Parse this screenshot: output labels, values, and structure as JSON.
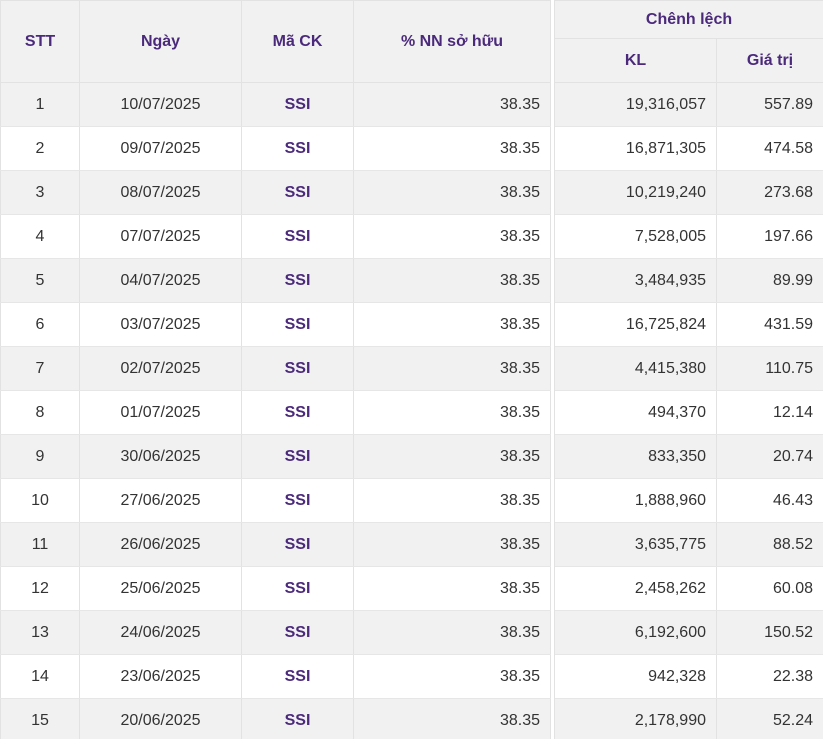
{
  "table": {
    "headers": {
      "stt": "STT",
      "date": "Ngày",
      "code": "Mã CK",
      "pct": "% NN sở hữu",
      "diff_group": "Chênh lệch",
      "kl": "KL",
      "value": "Giá trị"
    },
    "rows": [
      {
        "stt": "1",
        "date": "10/07/2025",
        "code": "SSI",
        "pct": "38.35",
        "kl": "19,316,057",
        "value": "557.89"
      },
      {
        "stt": "2",
        "date": "09/07/2025",
        "code": "SSI",
        "pct": "38.35",
        "kl": "16,871,305",
        "value": "474.58"
      },
      {
        "stt": "3",
        "date": "08/07/2025",
        "code": "SSI",
        "pct": "38.35",
        "kl": "10,219,240",
        "value": "273.68"
      },
      {
        "stt": "4",
        "date": "07/07/2025",
        "code": "SSI",
        "pct": "38.35",
        "kl": "7,528,005",
        "value": "197.66"
      },
      {
        "stt": "5",
        "date": "04/07/2025",
        "code": "SSI",
        "pct": "38.35",
        "kl": "3,484,935",
        "value": "89.99"
      },
      {
        "stt": "6",
        "date": "03/07/2025",
        "code": "SSI",
        "pct": "38.35",
        "kl": "16,725,824",
        "value": "431.59"
      },
      {
        "stt": "7",
        "date": "02/07/2025",
        "code": "SSI",
        "pct": "38.35",
        "kl": "4,415,380",
        "value": "110.75"
      },
      {
        "stt": "8",
        "date": "01/07/2025",
        "code": "SSI",
        "pct": "38.35",
        "kl": "494,370",
        "value": "12.14"
      },
      {
        "stt": "9",
        "date": "30/06/2025",
        "code": "SSI",
        "pct": "38.35",
        "kl": "833,350",
        "value": "20.74"
      },
      {
        "stt": "10",
        "date": "27/06/2025",
        "code": "SSI",
        "pct": "38.35",
        "kl": "1,888,960",
        "value": "46.43"
      },
      {
        "stt": "11",
        "date": "26/06/2025",
        "code": "SSI",
        "pct": "38.35",
        "kl": "3,635,775",
        "value": "88.52"
      },
      {
        "stt": "12",
        "date": "25/06/2025",
        "code": "SSI",
        "pct": "38.35",
        "kl": "2,458,262",
        "value": "60.08"
      },
      {
        "stt": "13",
        "date": "24/06/2025",
        "code": "SSI",
        "pct": "38.35",
        "kl": "6,192,600",
        "value": "150.52"
      },
      {
        "stt": "14",
        "date": "23/06/2025",
        "code": "SSI",
        "pct": "38.35",
        "kl": "942,328",
        "value": "22.38"
      },
      {
        "stt": "15",
        "date": "20/06/2025",
        "code": "SSI",
        "pct": "38.35",
        "kl": "2,178,990",
        "value": "52.24"
      }
    ]
  },
  "colors": {
    "header_text": "#4b2a7b",
    "code_text": "#4b2a7b",
    "stripe": "#f1f1f1",
    "border": "#e2e2e2"
  }
}
